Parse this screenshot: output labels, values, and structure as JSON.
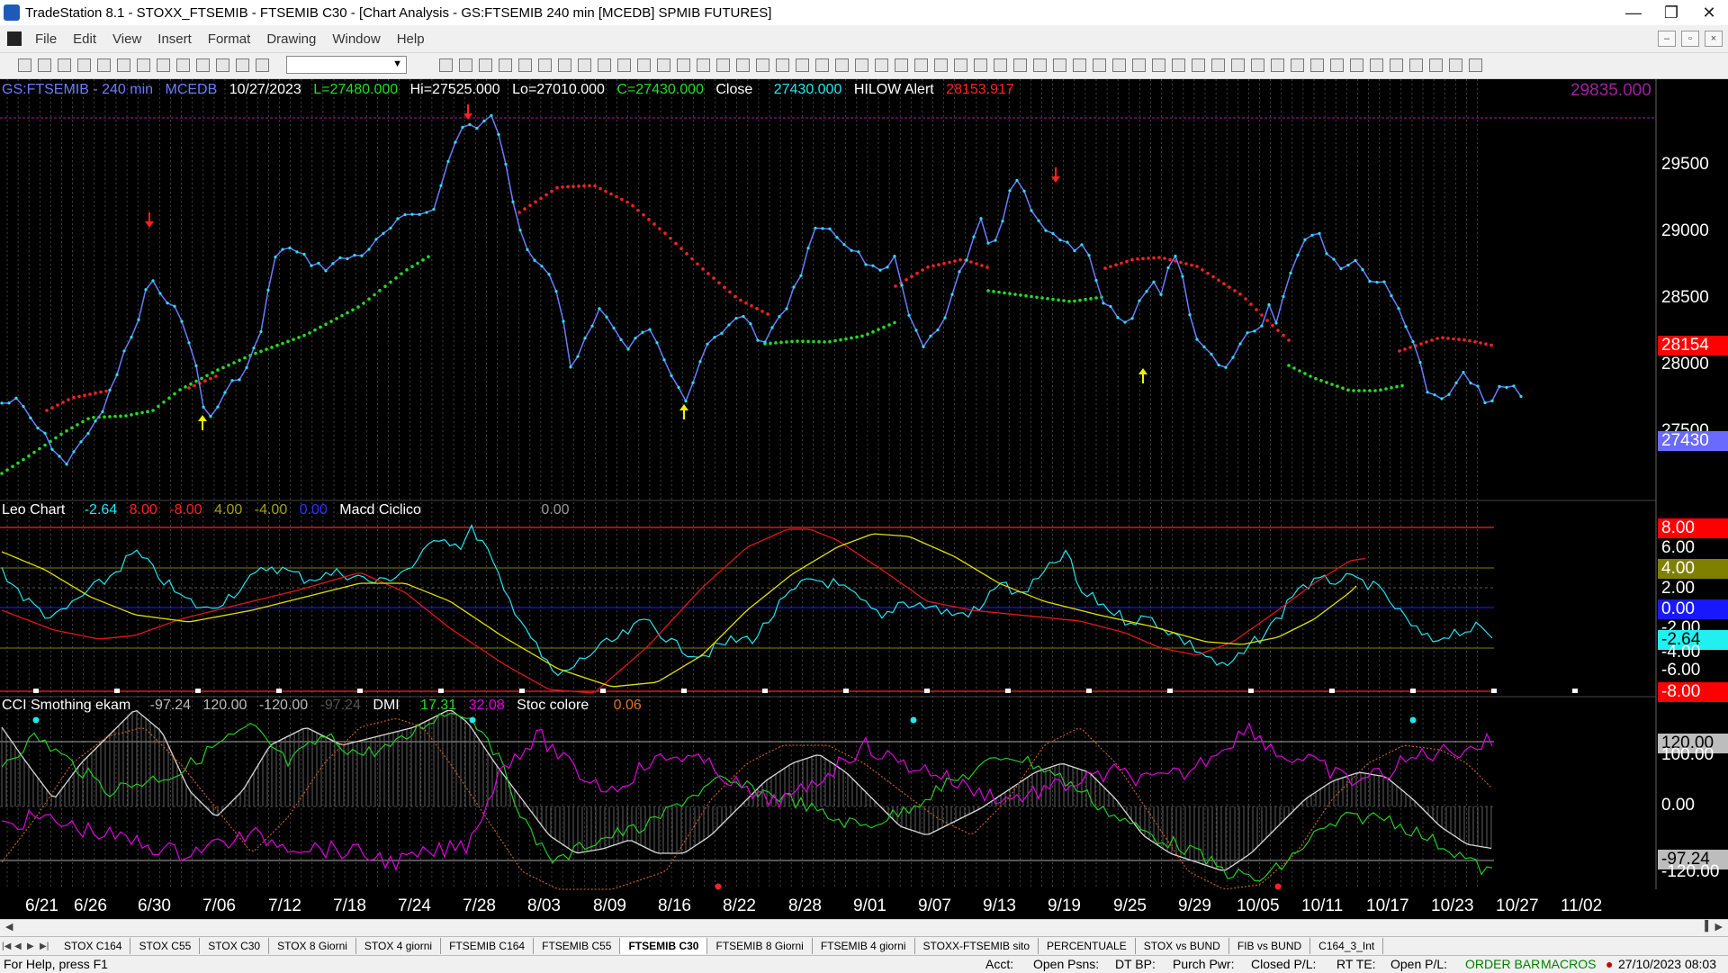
{
  "window": {
    "title": "TradeStation 8.1 - STOXX_FTSEMIB - FTSEMIB C30 - [Chart Analysis - GS:FTSEMIB  240 min  [MCEDB] SPMIB FUTURES]",
    "minimize": "—",
    "maximize": "❐",
    "close": "✕"
  },
  "menu": {
    "items": [
      "File",
      "Edit",
      "View",
      "Insert",
      "Format",
      "Drawing",
      "Window",
      "Help"
    ]
  },
  "price_header": {
    "symbol": "GS:FTSEMIB - 240 min",
    "source": "MCEDB",
    "date": "10/27/2023",
    "low_open": "L=27480.000",
    "high": "Hi=27525.000",
    "low": "Lo=27010.000",
    "close_val": "C=27430.000",
    "close_label": "Close",
    "close_num": "27430.000",
    "alert_label": "HILOW Alert",
    "alert_value": "28153.917",
    "top_value": "29835.000"
  },
  "price_axis": {
    "ticks": [
      "29500",
      "29000",
      "28500",
      "28000",
      "27500"
    ],
    "box_red": "28154",
    "box_blue": "27430"
  },
  "leo_header": {
    "name": "Leo Chart",
    "v1": "-2.64",
    "v2": "8.00",
    "v3": "-8.00",
    "v4": "4.00",
    "v5": "-4.00",
    "v6": "0.00",
    "name2": "Macd Ciclico",
    "v7": "0.00"
  },
  "leo_axis": {
    "ticks": [
      "6.00",
      "2.00",
      "-2.00",
      "-4.00",
      "-6.00"
    ],
    "box_red_top": "8.00",
    "box_olive": "4.00",
    "box_blue": "0.00",
    "box_cyan": "-2.64",
    "box_red_bottom": "-8.00"
  },
  "cci_header": {
    "name": "CCI Smothing ekam",
    "v1": "-97.24",
    "v2": "120.00",
    "v3": "-120.00",
    "v4": "-97.24",
    "name2": "DMI",
    "v5": "17.31",
    "v6": "32.08",
    "name3": "Stoc colore",
    "v7": "0.06"
  },
  "cci_axis": {
    "ticks": [
      "100.00",
      "0.00",
      "-120.00"
    ],
    "box_top": "120.00",
    "box_bottom": "-97.24"
  },
  "x_axis": {
    "labels": [
      "6/21",
      "6/26",
      "6/30",
      "7/06",
      "7/12",
      "7/18",
      "7/24",
      "7/28",
      "8/03",
      "8/09",
      "8/16",
      "8/22",
      "8/28",
      "9/01",
      "9/07",
      "9/13",
      "9/19",
      "9/25",
      "9/29",
      "10/05",
      "10/11",
      "10/17",
      "10/23",
      "10/27",
      "11/02"
    ]
  },
  "tabs": [
    "STOX C164",
    "STOX C55",
    "STOX  C30",
    "STOX  8 Giorni",
    "STOX 4 giorni",
    "FTSEMIB C164",
    "FTSEMIB C55",
    "FTSEMIB C30",
    "FTSEMIB  8 Giorni",
    "FTSEMIB  4 giorni",
    "STOXX-FTSEMIB sito",
    "PERCENTUALE",
    "STOX vs BUND",
    "FIB vs BUND",
    "C164_3_Int"
  ],
  "active_tab": "FTSEMIB C30",
  "status": {
    "help": "For Help, press F1",
    "acct": "Acct:",
    "open_psns": "Open Psns:",
    "dt_bp": "DT BP:",
    "purch_pwr": "Purch Pwr:",
    "closed_pl": "Closed P/L:",
    "rt_te": "RT TE:",
    "open_pl": "Open P/L:",
    "order_bar": "ORDER BAR",
    "macros": "MACROS",
    "datetime": "27/10/2023 08:03"
  },
  "colors": {
    "price_line": "#6a7cff",
    "bull_dots": "#22dd22",
    "bear_dots": "#ff2222",
    "cyan": "#22e6f0",
    "yellow": "#e0e000",
    "magenta": "#e000e0",
    "alert_red": "#ff2020"
  }
}
